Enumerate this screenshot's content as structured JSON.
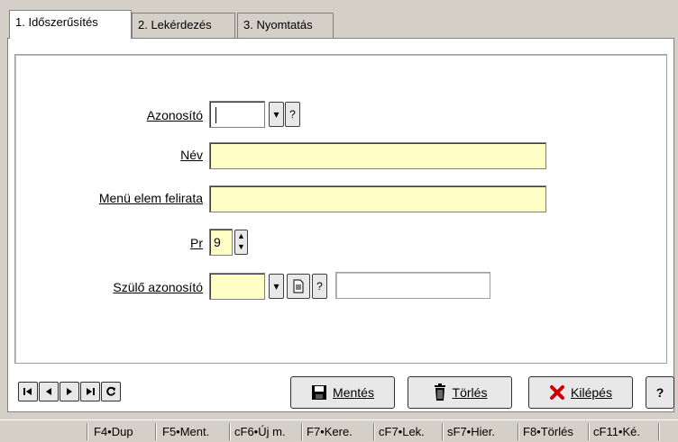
{
  "tabs": [
    {
      "label": "1. Időszerűsítés"
    },
    {
      "label": "2. Lekérdezés"
    },
    {
      "label": "3. Nyomtatás"
    }
  ],
  "form": {
    "azonosito_label": "Azonosító",
    "azonosito_value": "",
    "help_glyph": "?",
    "nev_label": "Név",
    "nev_value": "",
    "menu_label": "Menü elem felirata",
    "menu_value": "",
    "pr_label": "Pr",
    "pr_value": "9",
    "szulo_label": "Szülő azonosító",
    "szulo_value": "",
    "szulo_display": ""
  },
  "buttons": {
    "save": "Mentés",
    "delete": "Törlés",
    "exit": "Kilépés",
    "help": "?"
  },
  "statusbar": [
    "F4•Dup",
    "F5•Ment.",
    "cF6•Új m.",
    "F7•Kere.",
    "cF7•Lek.",
    "sF7•Hier.",
    "F8•Törlés",
    "cF11•Ké."
  ],
  "colors": {
    "window_bg": "#d4d0c8",
    "required_field": "#ffffc8",
    "exit_icon": "#cc0000"
  },
  "icons": [
    "first-record-icon",
    "prev-record-icon",
    "next-record-icon",
    "last-record-icon",
    "refresh-icon",
    "save-disk-icon",
    "trash-icon",
    "red-x-icon",
    "document-icon",
    "dropdown-arrow-icon",
    "spin-icon"
  ]
}
